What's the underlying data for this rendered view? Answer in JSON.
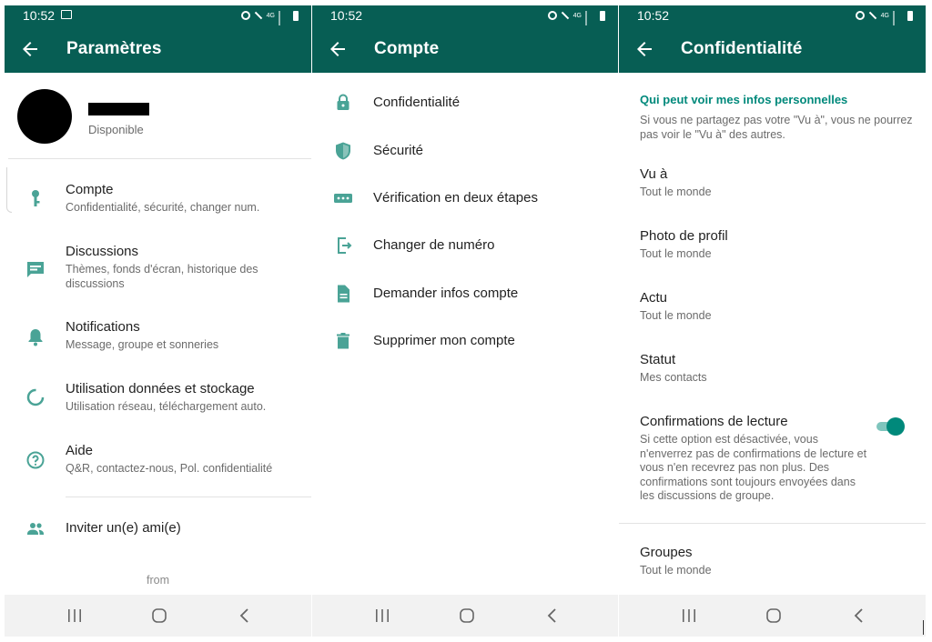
{
  "status_bar": {
    "time": "10:52",
    "network": "4G"
  },
  "screens": {
    "settings": {
      "title": "Paramètres",
      "profile": {
        "status": "Disponible"
      },
      "items": [
        {
          "title": "Compte",
          "desc": "Confidentialité, sécurité, changer num.",
          "icon": "key-icon"
        },
        {
          "title": "Discussions",
          "desc": "Thèmes, fonds d'écran, historique des discussions",
          "icon": "chat-icon"
        },
        {
          "title": "Notifications",
          "desc": "Message, groupe et sonneries",
          "icon": "bell-icon"
        },
        {
          "title": "Utilisation données et stockage",
          "desc": "Utilisation réseau, téléchargement auto.",
          "icon": "data-usage-icon"
        },
        {
          "title": "Aide",
          "desc": "Q&R, contactez-nous, Pol. confidentialité",
          "icon": "help-icon"
        },
        {
          "title": "Inviter un(e) ami(e)",
          "icon": "people-icon"
        }
      ],
      "footer": "from"
    },
    "account": {
      "title": "Compte",
      "items": [
        {
          "title": "Confidentialité",
          "icon": "lock-icon"
        },
        {
          "title": "Sécurité",
          "icon": "shield-icon"
        },
        {
          "title": "Vérification en deux étapes",
          "icon": "dots-icon"
        },
        {
          "title": "Changer de numéro",
          "icon": "change-number-icon"
        },
        {
          "title": "Demander infos compte",
          "icon": "document-icon"
        },
        {
          "title": "Supprimer mon compte",
          "icon": "trash-icon"
        }
      ]
    },
    "privacy": {
      "title": "Confidentialité",
      "section_header": "Qui peut voir mes infos personnelles",
      "section_desc": "Si vous ne partagez pas votre \"Vu à\", vous ne pourrez pas voir le \"Vu à\" des autres.",
      "items": [
        {
          "title": "Vu à",
          "value": "Tout le monde"
        },
        {
          "title": "Photo de profil",
          "value": "Tout le monde"
        },
        {
          "title": "Actu",
          "value": "Tout le monde"
        },
        {
          "title": "Statut",
          "value": "Mes contacts"
        }
      ],
      "read_receipts": {
        "title": "Confirmations de lecture",
        "desc": "Si cette option est désactivée, vous n'enverrez pas de confirmations de lecture et vous n'en recevrez pas non plus. Des confirmations sont toujours envoyées dans les discussions de groupe.",
        "enabled": true
      },
      "groups": {
        "title": "Groupes",
        "value": "Tout le monde"
      }
    }
  },
  "colors": {
    "header": "#075e54",
    "accent": "#00897b",
    "icon": "#4aa396"
  }
}
